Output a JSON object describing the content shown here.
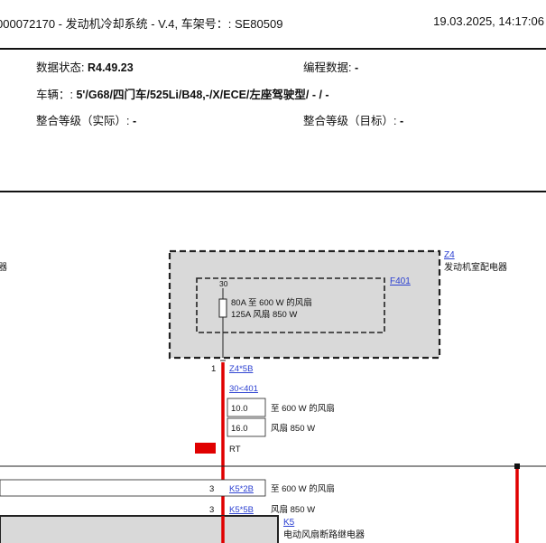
{
  "header": {
    "doc_title": "000072170 - 发动机冷却系统 - V.4, 车架号：: SE80509",
    "datetime": "19.03.2025, 14:17:06"
  },
  "vehicle_info": {
    "data_status_label": "数据状态:",
    "data_status_value": "R4.49.23",
    "programming_label": "编程数据:",
    "programming_value": "-",
    "vehicle_label": "车辆：:",
    "vehicle_value": "5'/G68/四门车/525Li/B48,-/X/ECE/左座驾驶型/ - / -",
    "integration_actual_label": "整合等级（实际）:",
    "integration_actual_value": "-",
    "integration_target_label": "整合等级（目标）:",
    "integration_target_value": "-"
  },
  "diagram": {
    "left_cut_label": "器",
    "z4": {
      "id": "Z4",
      "name": "发动机室配电器"
    },
    "fuse": {
      "id": "F401",
      "pin": "30",
      "rating_1": "80A 至 600 W 的风扇",
      "rating_2": "125A 风扇 850 W"
    },
    "conn_z4": {
      "pin": "1",
      "link": "Z4*5B"
    },
    "wire_ref": "30<401",
    "wire_table": [
      {
        "gauge": "10.0",
        "desc": "至 600 W 的风扇"
      },
      {
        "gauge": "16.0",
        "desc": "风扇 850 W"
      }
    ],
    "wire_color": {
      "code": "RT",
      "hex": "#e00000"
    },
    "conn_k5_a": {
      "pin": "3",
      "link": "K5*2B",
      "desc": "至 600 W 的风扇"
    },
    "conn_k5_b": {
      "pin": "3",
      "link": "K5*5B",
      "desc": "风扇 850 W"
    },
    "k5": {
      "id": "K5",
      "name": "电动风扇断路继电器"
    }
  }
}
